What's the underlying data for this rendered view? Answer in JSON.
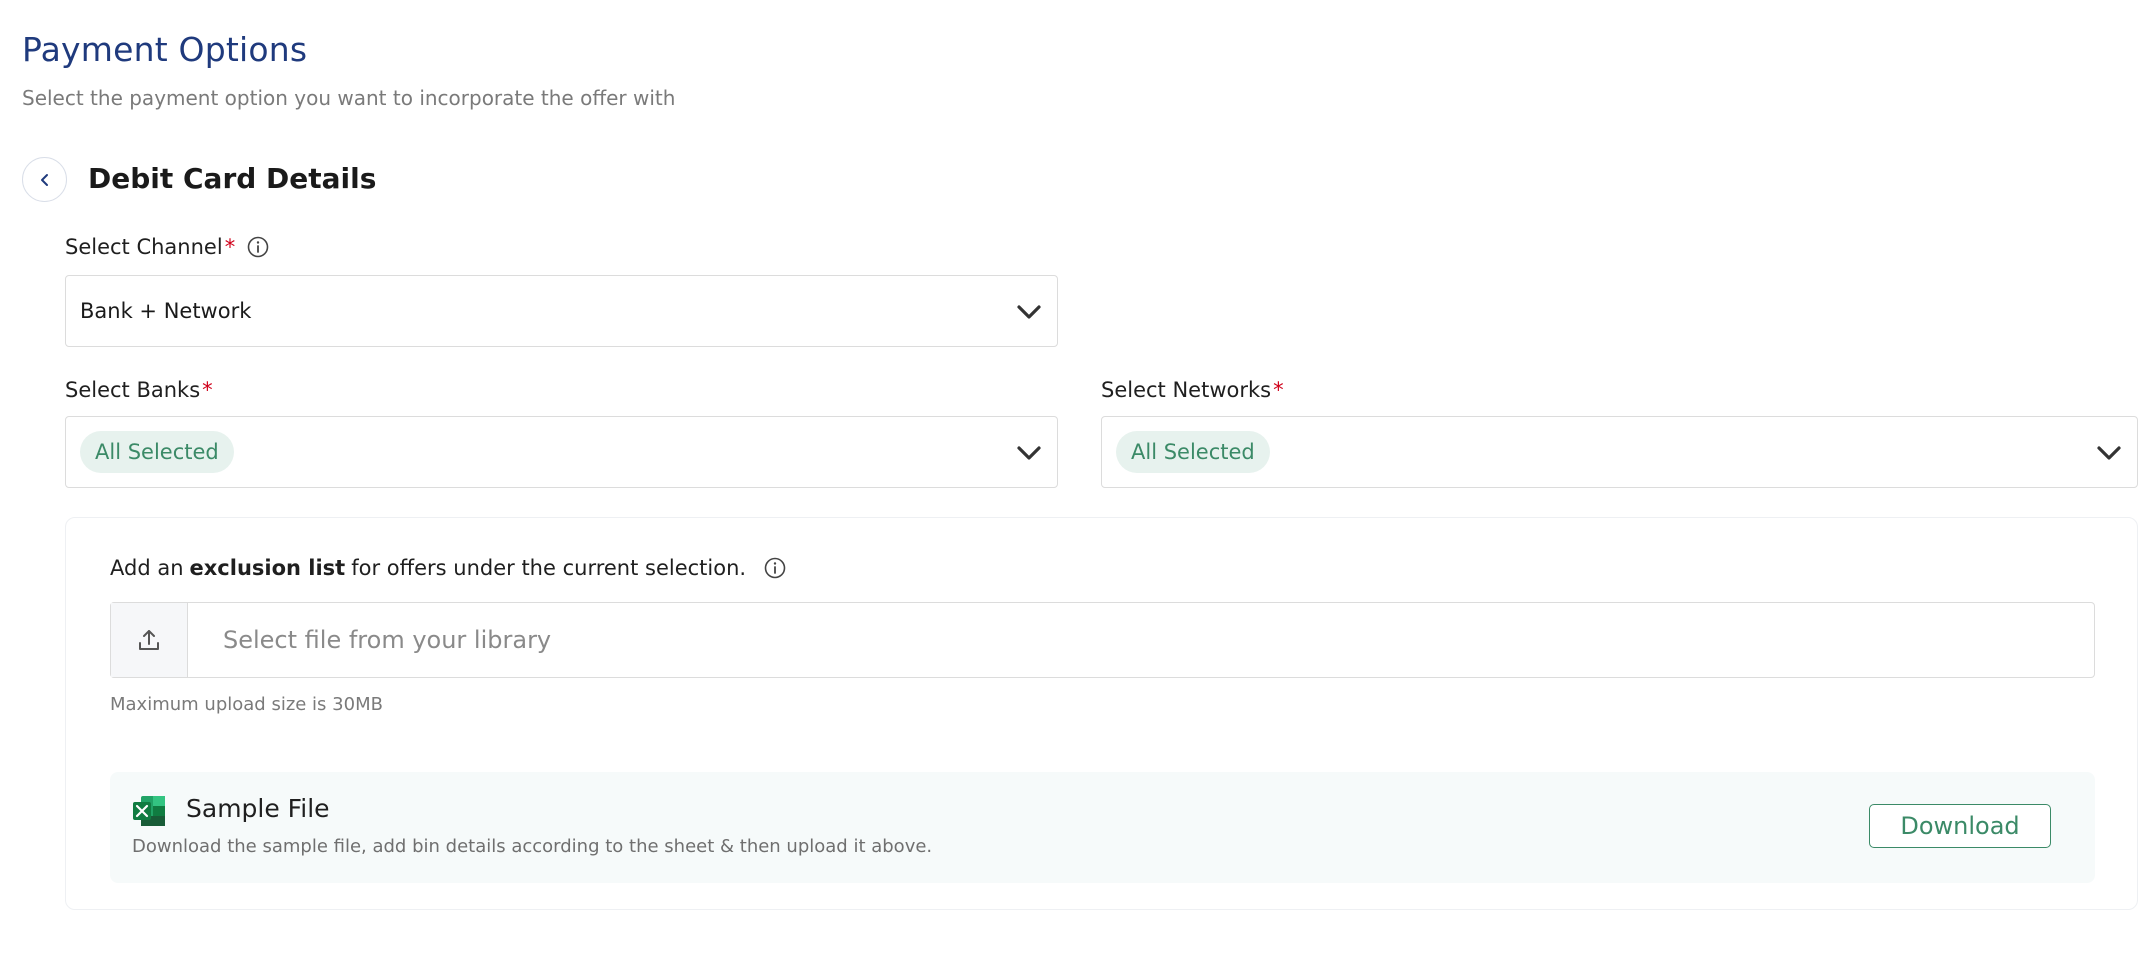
{
  "header": {
    "title": "Payment Options",
    "subtitle": "Select the payment option you want to incorporate the offer with"
  },
  "section": {
    "title": "Debit Card Details"
  },
  "channel": {
    "label": "Select Channel",
    "required_mark": "*",
    "value": "Bank + Network"
  },
  "banks": {
    "label": "Select Banks",
    "required_mark": "*",
    "chip": "All Selected"
  },
  "networks": {
    "label": "Select Networks",
    "required_mark": "*",
    "chip": "All Selected"
  },
  "exclusion": {
    "prefix": "Add an",
    "bold": "exclusion list",
    "suffix": "for offers under the current selection.",
    "upload_placeholder": "Select file from your library",
    "upload_hint": "Maximum upload size is 30MB"
  },
  "sample": {
    "title": "Sample File",
    "description": "Download the sample file, add bin details according to the sheet & then upload it above.",
    "download_label": "Download"
  },
  "icons": {
    "back": "chevron-left-icon",
    "info": "info-icon",
    "dropdown": "chevron-down-icon",
    "upload": "upload-icon",
    "excel": "excel-file-icon"
  },
  "colors": {
    "title": "#1f3a7d",
    "accent_green": "#3b8a67",
    "chip_bg": "#e7f2ee",
    "required": "#d0021b"
  }
}
